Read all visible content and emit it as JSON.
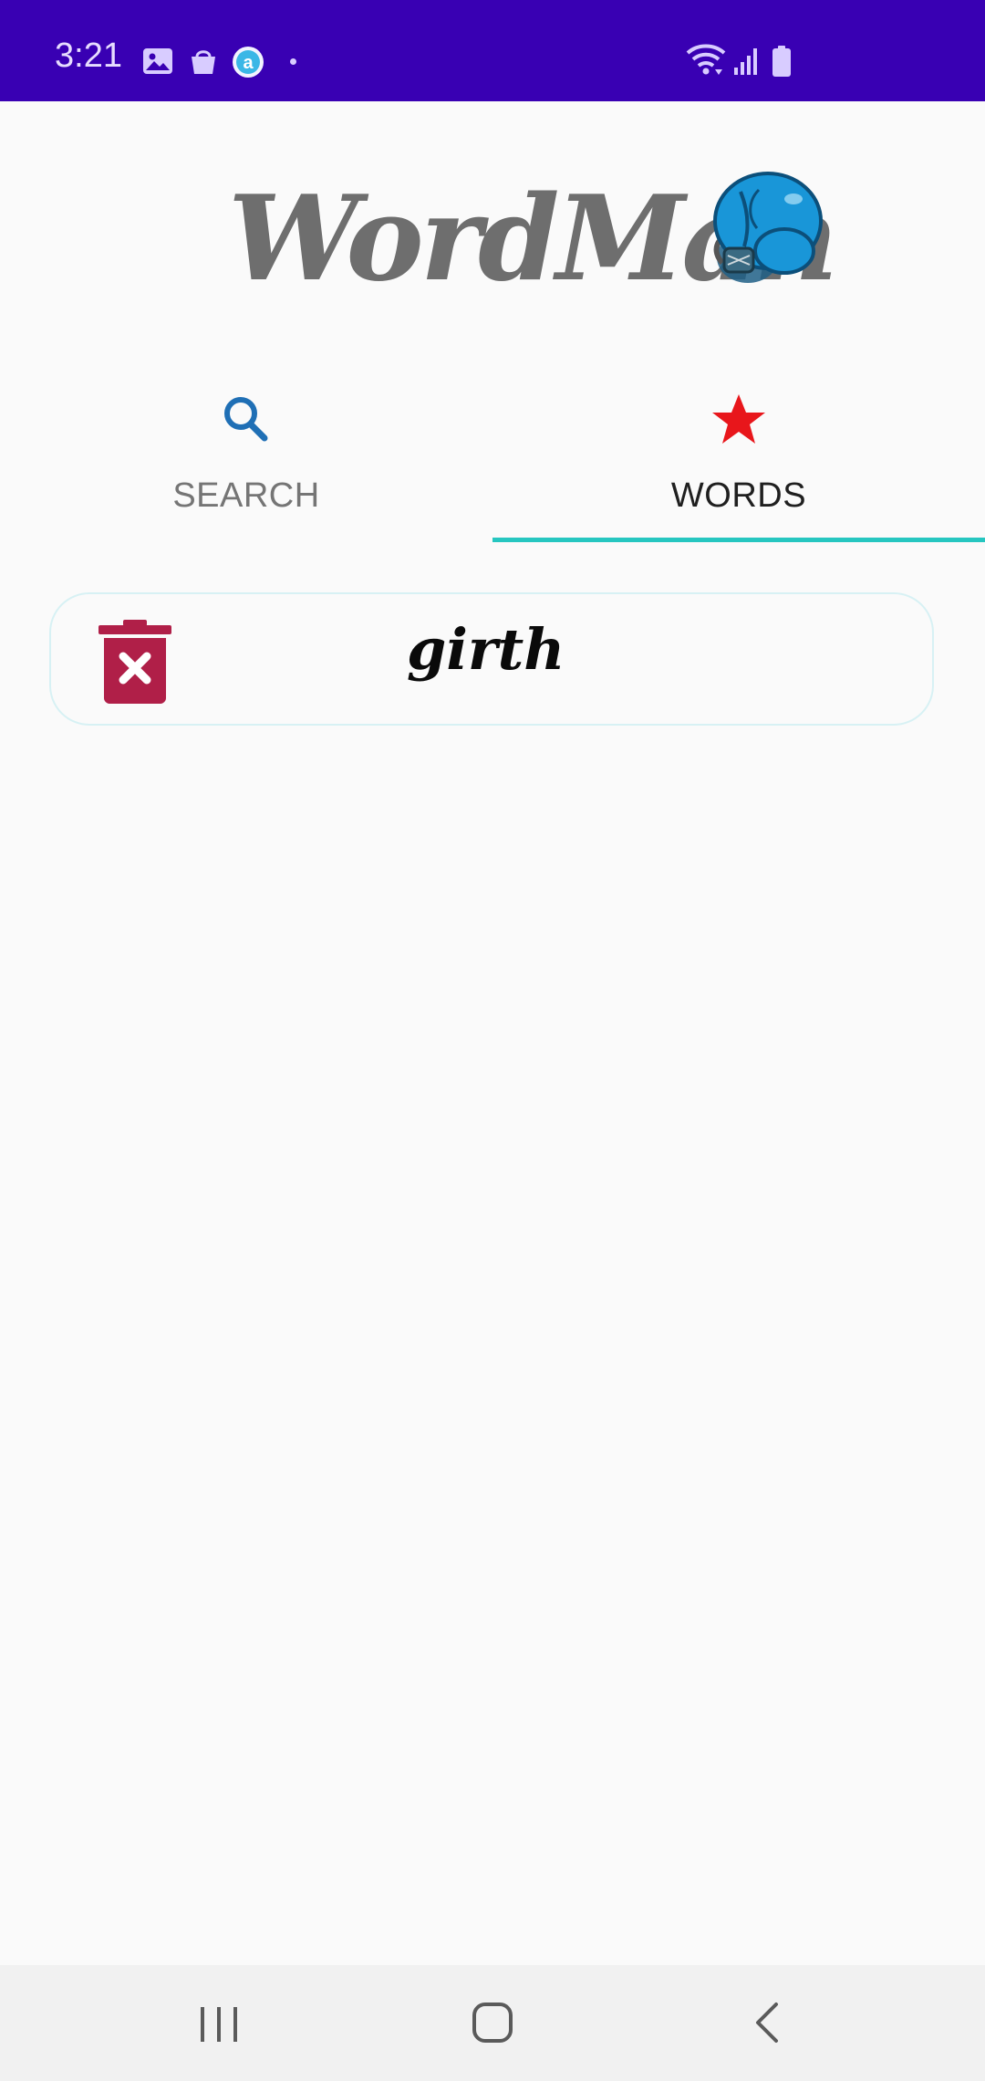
{
  "status_bar": {
    "time": "3:21",
    "background_color": "#3900b3",
    "icons": [
      "image-icon",
      "shopping-bag-icon",
      "app-a-icon",
      "dot-icon",
      "wifi-icon",
      "signal-icon",
      "battery-icon"
    ]
  },
  "logo": {
    "text": "WordMan",
    "color": "#6e6e6e",
    "mascot": "boxing-glove-icon"
  },
  "tabs": [
    {
      "label": "SEARCH",
      "icon": "search-icon",
      "selected": false
    },
    {
      "label": "WORDS",
      "icon": "star-icon",
      "selected": true
    }
  ],
  "colors": {
    "tab_indicator": "#26c6c0",
    "search_icon": "#1f6fb5",
    "star_icon": "#e8161b",
    "delete_icon": "#b01f48",
    "card_border": "#d7f1f4"
  },
  "words": [
    {
      "word": "girth",
      "delete_icon": "trash-x-icon"
    }
  ],
  "nav_bar": {
    "buttons": [
      "recent-apps-icon",
      "home-icon",
      "back-icon"
    ]
  }
}
